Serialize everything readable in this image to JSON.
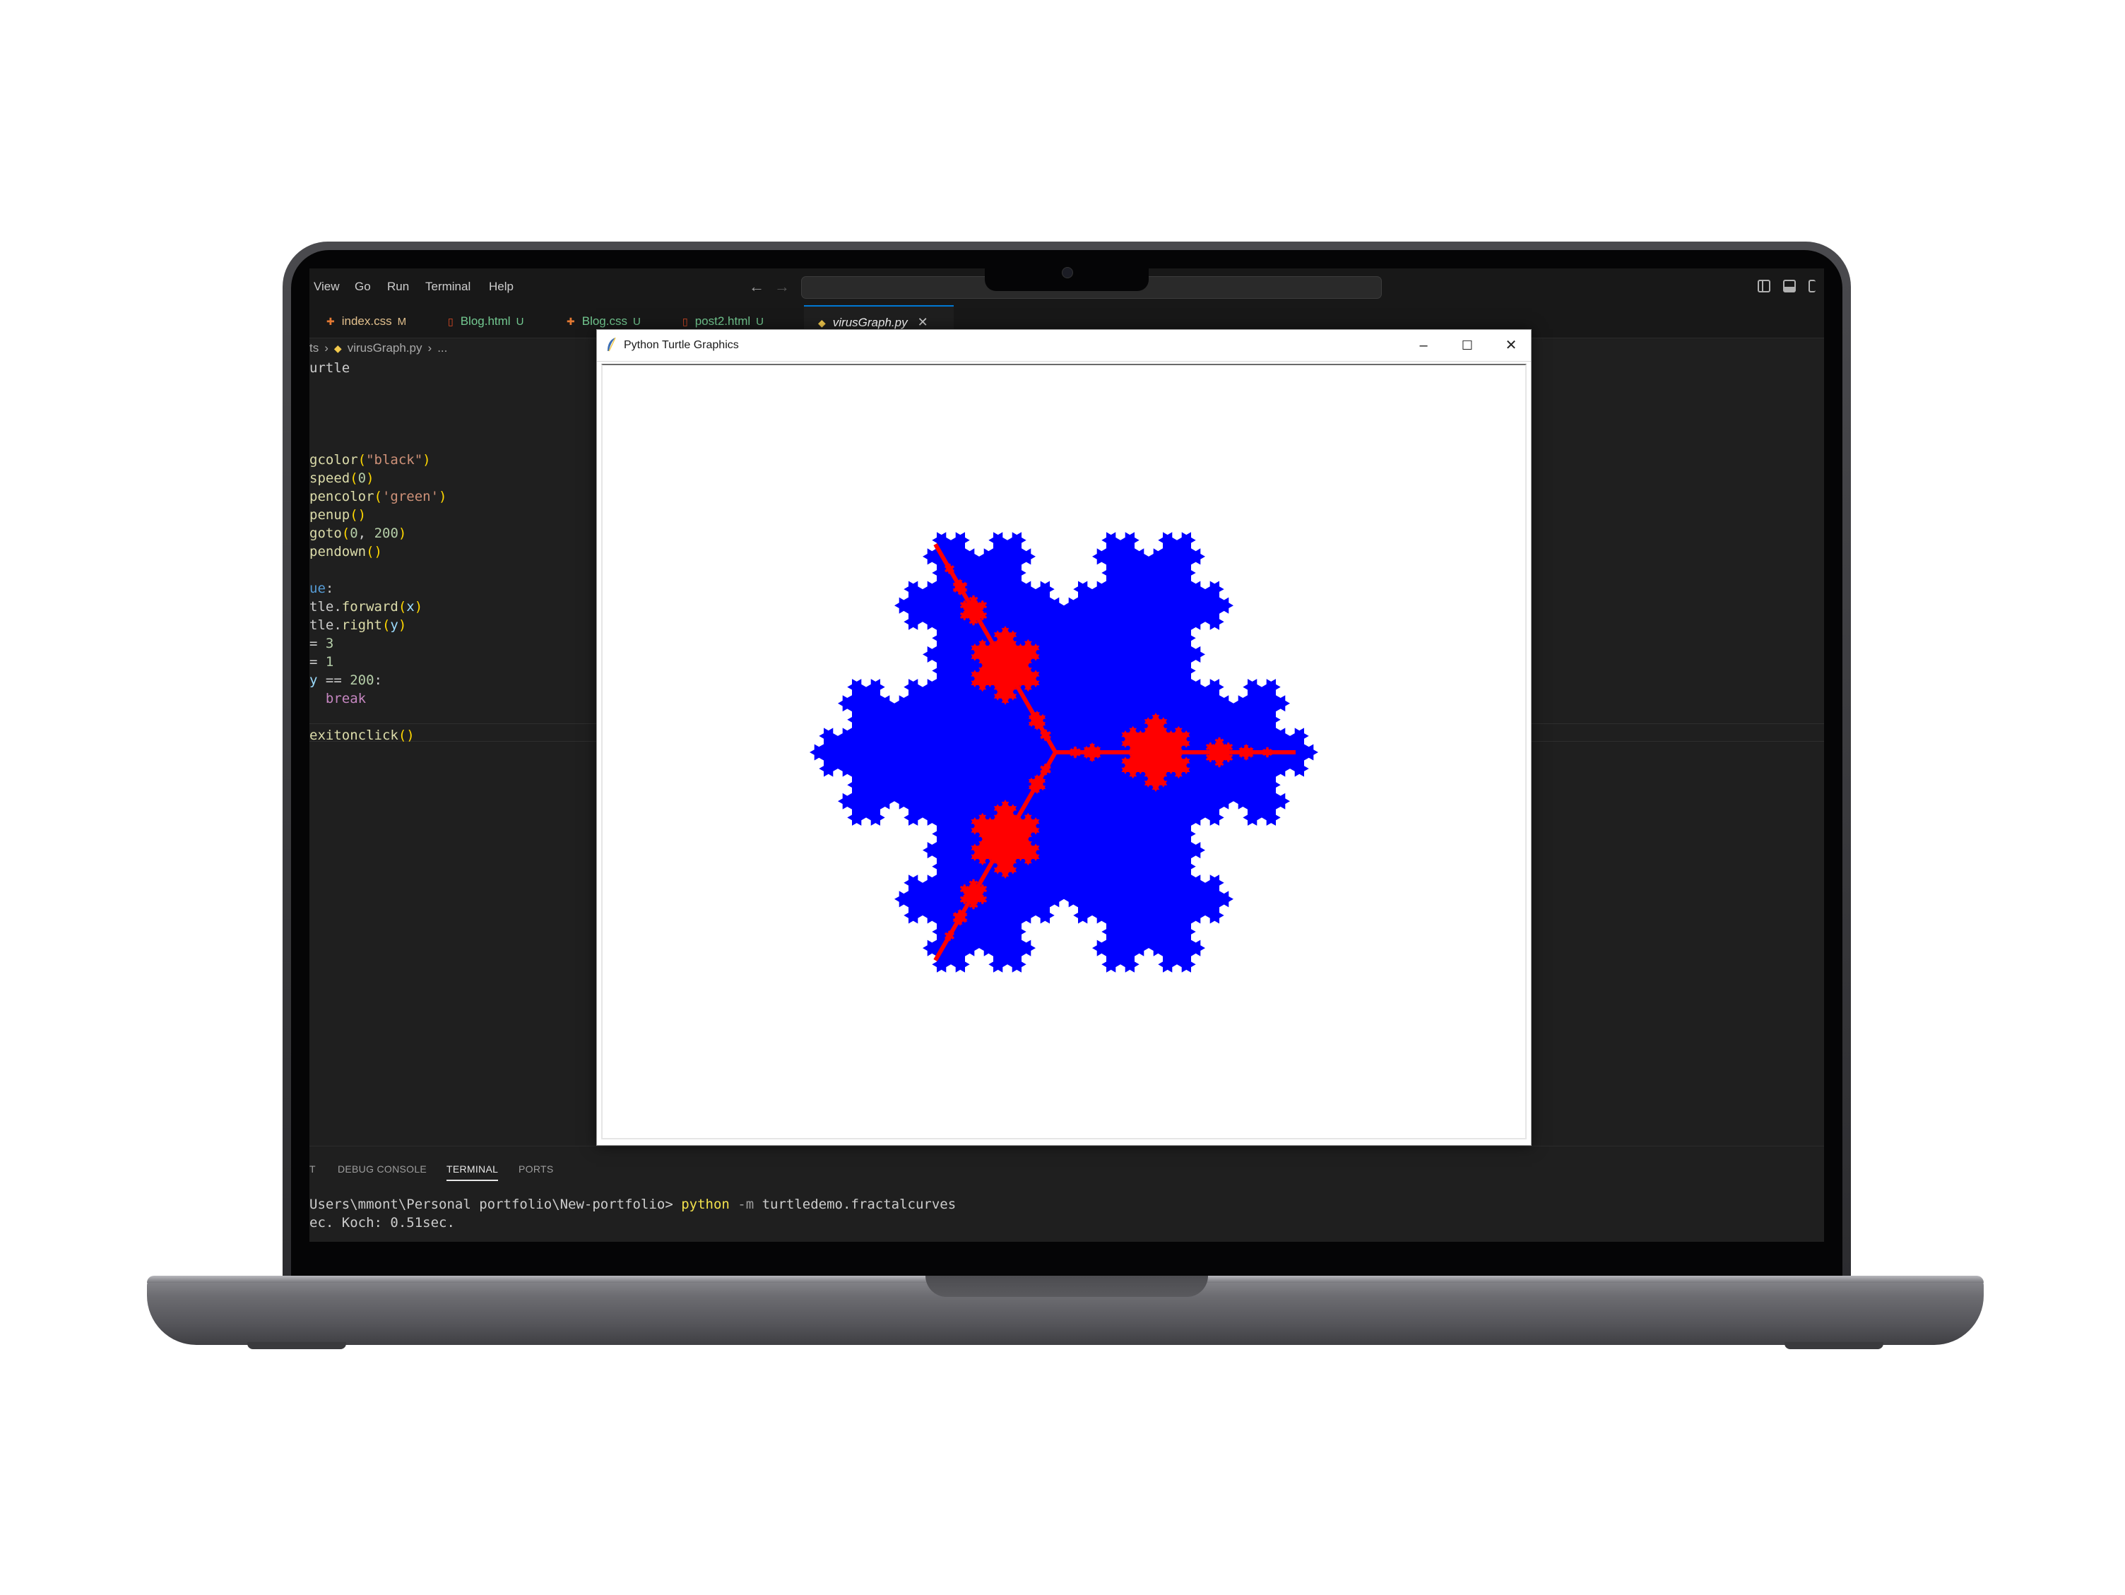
{
  "menu": [
    "View",
    "Go",
    "Run",
    "Terminal",
    "Help"
  ],
  "nav": {
    "back_icon": "←",
    "forward_icon": "→"
  },
  "tabs": [
    {
      "name": "index.css",
      "status": "M",
      "icon": "css-file-icon",
      "icon_glyph": "✚",
      "icon_color": "#e37933",
      "label_color": "#e2c08d",
      "status_color": "#e2c08d"
    },
    {
      "name": "Blog.html",
      "status": "U",
      "icon": "html-file-icon",
      "icon_glyph": "▯",
      "icon_color": "#e44d26",
      "label_color": "#73c991",
      "status_color": "#73c991"
    },
    {
      "name": "Blog.css",
      "status": "U",
      "icon": "css-file-icon",
      "icon_glyph": "✚",
      "icon_color": "#e37933",
      "label_color": "#73c991",
      "status_color": "#73c991"
    },
    {
      "name": "post2.html",
      "status": "U",
      "icon": "html-file-icon",
      "icon_glyph": "▯",
      "icon_color": "#e44d26",
      "label_color": "#73c991",
      "status_color": "#73c991"
    },
    {
      "name": "virusGraph.py",
      "status": "",
      "icon": "python-file-icon",
      "icon_glyph": "◆",
      "icon_color": "#f2c94c",
      "label_color": "#ffffff",
      "close": "✕",
      "active": true
    }
  ],
  "breadcrumb": {
    "prefix": "ts",
    "file": "virusGraph.py",
    "tail": "..."
  },
  "code": [
    {
      "row": 0,
      "parts": [
        [
          "urtle",
          "#cccccc"
        ]
      ]
    },
    {
      "row": 5,
      "parts": [
        [
          "gcolor",
          "#dcdcaa"
        ],
        [
          "(",
          "#ffd700"
        ],
        [
          "\"black\"",
          "#ce9178"
        ],
        [
          ")",
          "#ffd700"
        ]
      ]
    },
    {
      "row": 6,
      "parts": [
        [
          "speed",
          "#dcdcaa"
        ],
        [
          "(",
          "#ffd700"
        ],
        [
          "0",
          "#b5cea8"
        ],
        [
          ")",
          "#ffd700"
        ]
      ]
    },
    {
      "row": 7,
      "parts": [
        [
          "pencolor",
          "#dcdcaa"
        ],
        [
          "(",
          "#ffd700"
        ],
        [
          "'green'",
          "#ce9178"
        ],
        [
          ")",
          "#ffd700"
        ]
      ]
    },
    {
      "row": 8,
      "parts": [
        [
          "penup",
          "#dcdcaa"
        ],
        [
          "()",
          "#ffd700"
        ]
      ]
    },
    {
      "row": 9,
      "parts": [
        [
          "goto",
          "#dcdcaa"
        ],
        [
          "(",
          "#ffd700"
        ],
        [
          "0",
          "#b5cea8"
        ],
        [
          ", ",
          "#cccccc"
        ],
        [
          "200",
          "#b5cea8"
        ],
        [
          ")",
          "#ffd700"
        ]
      ]
    },
    {
      "row": 10,
      "parts": [
        [
          "pendown",
          "#dcdcaa"
        ],
        [
          "()",
          "#ffd700"
        ]
      ]
    },
    {
      "row": 12,
      "parts": [
        [
          "ue",
          "#569cd6"
        ],
        [
          ":",
          "#cccccc"
        ]
      ]
    },
    {
      "row": 13,
      "parts": [
        [
          "tle.",
          "#cccccc"
        ],
        [
          "forward",
          "#dcdcaa"
        ],
        [
          "(",
          "#ffd700"
        ],
        [
          "x",
          "#9cdcfe"
        ],
        [
          ")",
          "#ffd700"
        ]
      ]
    },
    {
      "row": 14,
      "parts": [
        [
          "tle.",
          "#cccccc"
        ],
        [
          "right",
          "#dcdcaa"
        ],
        [
          "(",
          "#ffd700"
        ],
        [
          "y",
          "#9cdcfe"
        ],
        [
          ")",
          "#ffd700"
        ]
      ]
    },
    {
      "row": 15,
      "parts": [
        [
          "= ",
          "#cccccc"
        ],
        [
          "3",
          "#b5cea8"
        ]
      ]
    },
    {
      "row": 16,
      "parts": [
        [
          "= ",
          "#cccccc"
        ],
        [
          "1",
          "#b5cea8"
        ]
      ]
    },
    {
      "row": 17,
      "parts": [
        [
          "y",
          "#9cdcfe"
        ],
        [
          " == ",
          "#cccccc"
        ],
        [
          "200",
          "#b5cea8"
        ],
        [
          ":",
          "#cccccc"
        ]
      ]
    },
    {
      "row": 18,
      "parts": [
        [
          "  ",
          "#cccccc"
        ],
        [
          "break",
          "#c586c0"
        ]
      ]
    },
    {
      "row": 20,
      "parts": [
        [
          "exitonclick",
          "#dcdcaa"
        ],
        [
          "()",
          "#ffd700"
        ]
      ]
    }
  ],
  "panel_tabs": [
    {
      "label": "T",
      "active": false
    },
    {
      "label": "DEBUG CONSOLE",
      "active": false
    },
    {
      "label": "TERMINAL",
      "active": true
    },
    {
      "label": "PORTS",
      "active": false
    }
  ],
  "terminal": {
    "prompt": "Users\\mmont\\Personal portfolio\\New-portfolio> ",
    "command": "python",
    "flag": " -m ",
    "args": "turtledemo.fractalcurves",
    "output": "ec. Koch: 0.51sec."
  },
  "turtle_window": {
    "title": "Python Turtle Graphics",
    "minimize": "–",
    "maximize": "☐",
    "close": "✕"
  },
  "colors": {
    "editor_bg": "#1f1f1f",
    "fractal_fill": "#0000ff",
    "fractal_red": "#ff0000",
    "terminal_command": "#f2e14c"
  }
}
